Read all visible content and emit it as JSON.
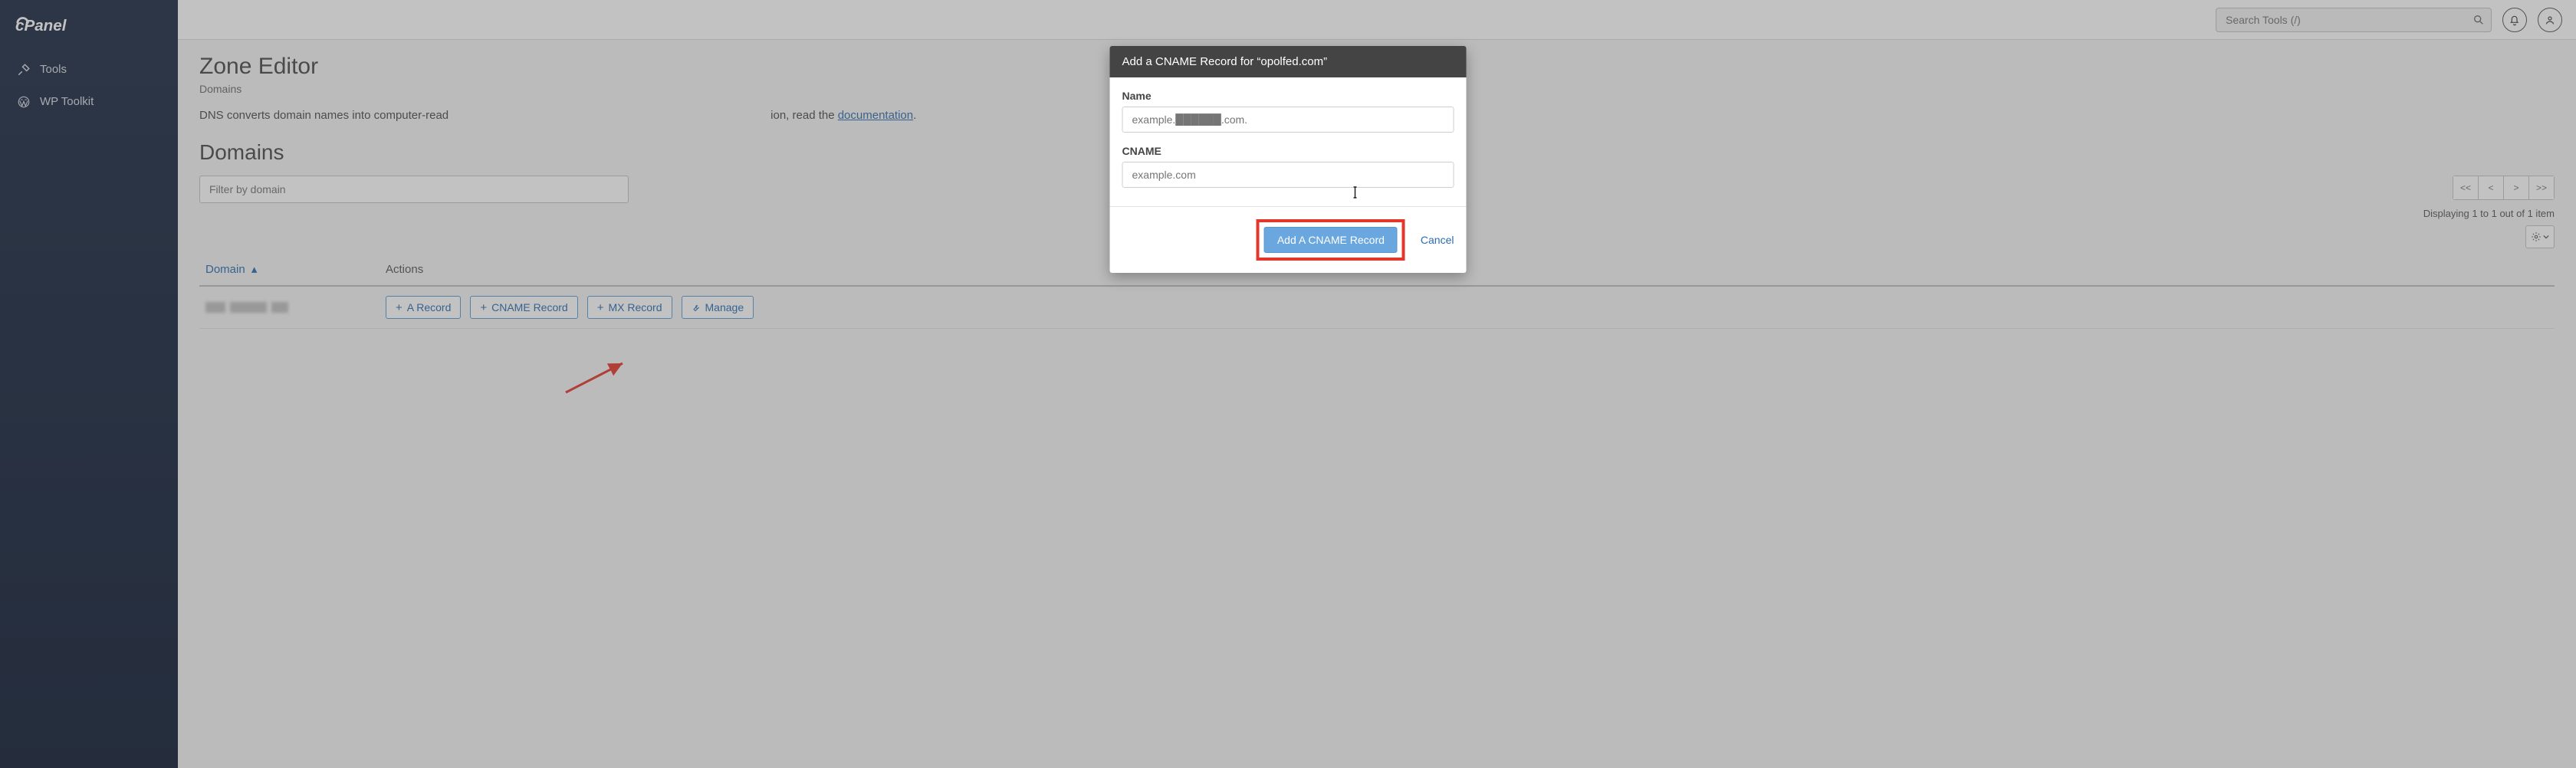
{
  "brand": "cPanel",
  "sidebar": {
    "items": [
      {
        "label": "Tools",
        "icon": "tools-icon"
      },
      {
        "label": "WP Toolkit",
        "icon": "wordpress-icon"
      }
    ]
  },
  "topbar": {
    "search_placeholder": "Search Tools (/)"
  },
  "page": {
    "title": "Zone Editor",
    "breadcrumb": "Domains",
    "description_prefix": "DNS converts domain names into computer-read",
    "description_suffix": "ion, read the ",
    "doc_link_label": "documentation",
    "description_end": "."
  },
  "domains_section": {
    "title": "Domains",
    "filter_placeholder": "Filter by domain",
    "pager": {
      "first": "<<",
      "prev": "<",
      "next": ">",
      "last": ">>"
    },
    "display_info": "Displaying 1 to 1 out of 1 item",
    "columns": {
      "domain": "Domain",
      "actions": "Actions"
    },
    "action_buttons": {
      "a_record": "A Record",
      "cname_record": "CNAME Record",
      "mx_record": "MX Record",
      "manage": "Manage"
    }
  },
  "modal": {
    "title": "Add a CNAME Record for “opolfed.com”",
    "name_label": "Name",
    "name_placeholder": "example.██████.com.",
    "cname_label": "CNAME",
    "cname_placeholder": "example.com",
    "submit_label": "Add A CNAME Record",
    "cancel_label": "Cancel"
  }
}
